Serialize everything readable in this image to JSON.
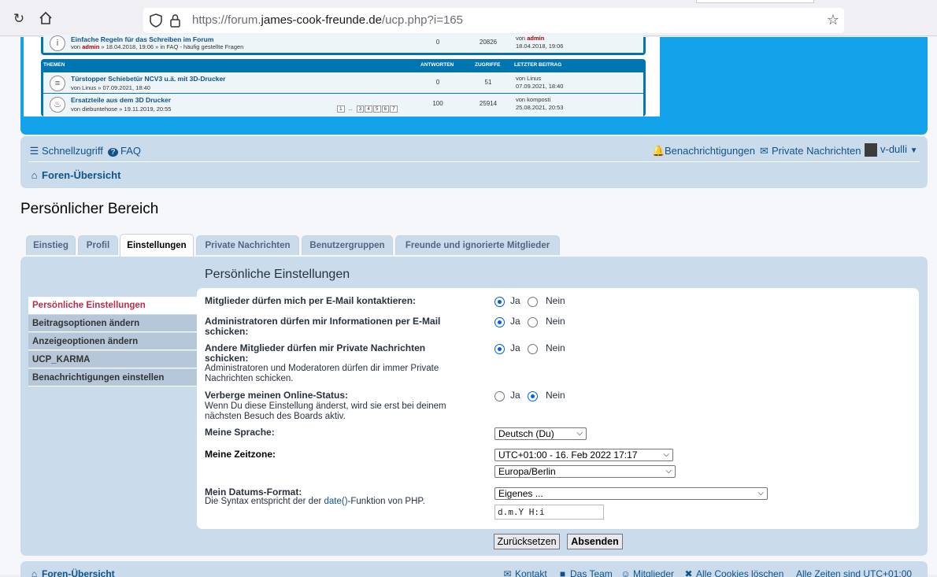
{
  "browser": {
    "url_prefix": "https://forum.",
    "url_domain": "james-cook-freunde.de",
    "url_path": "/ucp.php?i=165"
  },
  "embedded_topics": {
    "rows_top": [
      {
        "title": "Einfache Regeln für das Schreiben im Forum",
        "by": "von",
        "author": "admin",
        "meta": "» 18.04.2018, 19:06 » in FAQ - häufig gestellte Fragen",
        "replies": "0",
        "views": "20826",
        "last_by": "von",
        "last_author": "admin",
        "last_date": "18.04.2018, 19:06"
      }
    ],
    "headers": {
      "topics": "THEMEN",
      "replies": "ANTWORTEN",
      "views": "ZUGRIFFE",
      "last": "LETZTER BEITRAG"
    },
    "rows": [
      {
        "title": "Türstopper Schiebetür NCV3 u.ä. mit 3D-Drucker",
        "sub": "von Linus » 07.09.2021, 18:40",
        "replies": "0",
        "views": "51",
        "last_by": "von Linus",
        "last_date": "07.09.2021, 18:40"
      },
      {
        "title": "Ersatzteile aus dem 3D Drucker",
        "sub": "von diebuntehose » 19.11.2019, 20:55",
        "replies": "100",
        "views": "25914",
        "last_by": "von komposti",
        "last_date": "25.08.2021, 20:53",
        "pages": [
          "1",
          "...",
          "3",
          "4",
          "5",
          "6",
          "7"
        ]
      }
    ]
  },
  "navbar": {
    "quicklinks": "Schnellzugriff",
    "faq": "FAQ",
    "notifications": "Benachrichtigungen",
    "pm": "Private Nachrichten",
    "user": "v-dulli",
    "board_index": "Foren-Übersicht"
  },
  "page_title": "Persönlicher Bereich",
  "tabs": [
    {
      "label": "Einstieg"
    },
    {
      "label": "Profil"
    },
    {
      "label": "Einstellungen"
    },
    {
      "label": "Private Nachrichten"
    },
    {
      "label": "Benutzergruppen"
    },
    {
      "label": "Freunde und ignorierte Mitglieder"
    }
  ],
  "sidebar": [
    {
      "label": "Persönliche Einstellungen"
    },
    {
      "label": "Beitragsoptionen ändern"
    },
    {
      "label": "Anzeigeoptionen ändern"
    },
    {
      "label": "UCP_KARMA"
    },
    {
      "label": "Benachrichtigungen einstellen"
    }
  ],
  "section_title": "Persönliche Einstellungen",
  "form": {
    "yes": "Ja",
    "no": "Nein",
    "email_label": "Mitglieder dürfen mich per E-Mail kontaktieren:",
    "admin_email_label_1": "Administratoren dürfen mir Informationen per E-Mail",
    "admin_email_label_2": "schicken:",
    "pm_label_1": "Andere Mitglieder dürfen mir Private Nachrichten",
    "pm_label_2": "schicken:",
    "pm_explain_1": "Administratoren und Moderatoren dürfen dir immer Private",
    "pm_explain_2": "Nachrichten schicken.",
    "hide_label": "Verberge meinen Online-Status:",
    "hide_explain_1": "Wenn Du diese Einstellung änderst, wird sie erst bei deinem",
    "hide_explain_2": "nächsten Besuch des Boards aktiv.",
    "lang_label": "Meine Sprache:",
    "lang_value": "Deutsch (Du)",
    "tz_label": "Meine Zeitzone:",
    "tz_value": "UTC+01:00 - 16. Feb 2022 17:17",
    "tz_region": "Europa/Berlin",
    "date_label": "Mein Datums-Format:",
    "date_explain_pre": "Die Syntax entspricht der der ",
    "date_explain_link": "date()",
    "date_explain_post": "-Funktion von PHP.",
    "date_select": "Eigenes ...",
    "date_custom": "d.m.Y H:i",
    "reset": "Zurücksetzen",
    "submit": "Absenden",
    "email_choice": "yes",
    "admin_choice": "yes",
    "pm_choice": "yes",
    "hide_choice": "no"
  },
  "footer": {
    "board_index": "Foren-Übersicht",
    "contact": "Kontakt",
    "team": "Das Team",
    "members": "Mitglieder",
    "cookies": "Alle Cookies löschen",
    "times": "Alle Zeiten sind UTC+01:00"
  },
  "colors": {
    "accent_blue": "#12a3eb",
    "panel_bg": "#cadceb",
    "active_side": "#bc2a4d",
    "link": "#105289"
  }
}
